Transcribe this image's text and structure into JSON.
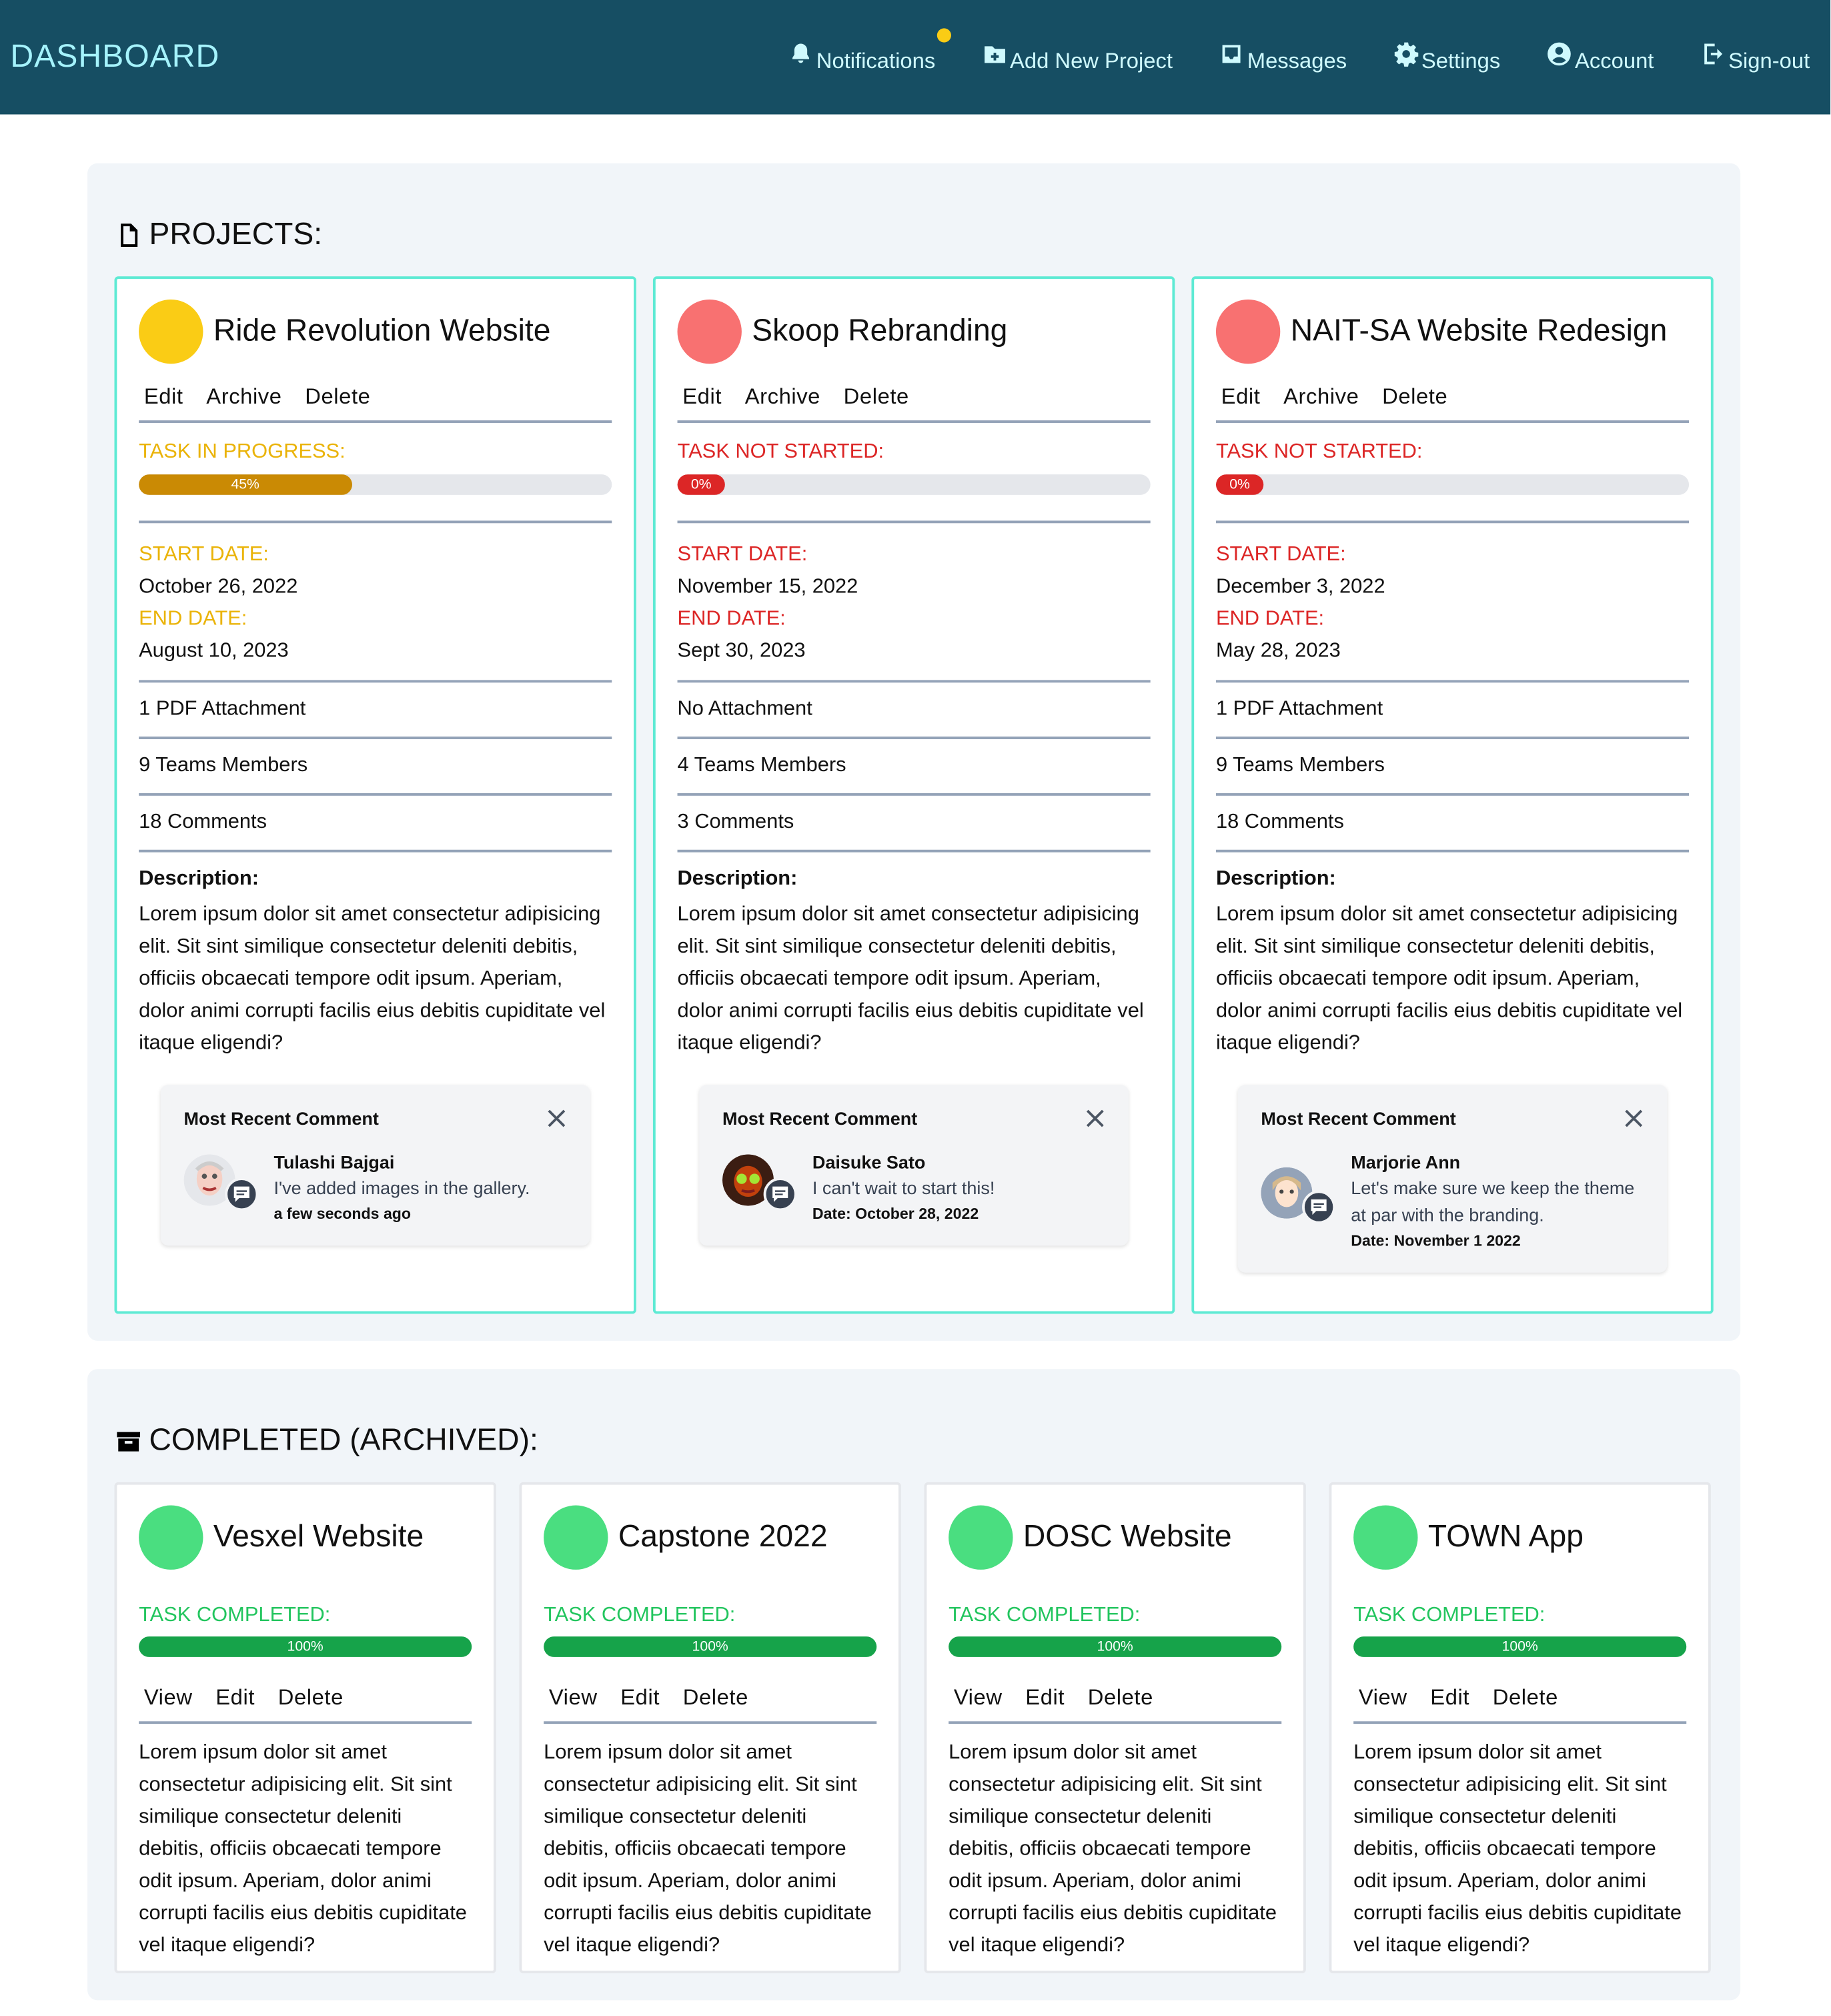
{
  "brand": "DASHBOARD",
  "nav": [
    {
      "label": "Notifications",
      "icon": "bell-icon"
    },
    {
      "label": "Add New Project",
      "icon": "folder-plus-icon"
    },
    {
      "label": "Messages",
      "icon": "inbox-icon"
    },
    {
      "label": "Settings",
      "icon": "gear-icon"
    },
    {
      "label": "Account",
      "icon": "user-circle-icon"
    },
    {
      "label": "Sign-out",
      "icon": "sign-out-icon"
    }
  ],
  "colors": {
    "header": "#164e63",
    "in_progress": "#eab308",
    "in_progress_bar": "#ca8a04",
    "not_started": "#dc2626",
    "not_started_dot": "#f87171",
    "completed": "#22c55e",
    "completed_dot": "#4ade80",
    "card_border": "#5eead4",
    "notif_dot": "#facc15"
  },
  "projects_section": {
    "title": "PROJECTS:",
    "actions": [
      "Edit",
      "Archive",
      "Delete"
    ],
    "start_label": "START DATE:",
    "end_label": "END DATE:",
    "description_label": "Description:",
    "comment_header": "Most Recent Comment",
    "cards": [
      {
        "title": "Ride Revolution Website",
        "status": "TASK IN PROGRESS:",
        "progress": 45,
        "progress_label": "45%",
        "start": "October 26, 2022",
        "end": "August 10, 2023",
        "attachment": "1 PDF Attachment",
        "members": "9 Teams Members",
        "comments": "18 Comments",
        "description": "Lorem ipsum dolor sit amet consectetur adipisicing elit. Sit sint similique consectetur deleniti debitis, officiis obcaecati tempore odit ipsum. Aperiam, dolor animi corrupti facilis eius debitis cupiditate vel itaque eligendi?",
        "comment_author": "Tulashi Bajgai",
        "comment_text": "I've added images in the gallery.",
        "comment_date": "a few seconds ago"
      },
      {
        "title": "Skoop Rebranding",
        "status": "TASK NOT STARTED:",
        "progress": 0,
        "progress_label": "0%",
        "start": "November 15, 2022",
        "end": "Sept 30, 2023",
        "attachment": "No Attachment",
        "members": "4 Teams Members",
        "comments": "3 Comments",
        "description": "Lorem ipsum dolor sit amet consectetur adipisicing elit. Sit sint similique consectetur deleniti debitis, officiis obcaecati tempore odit ipsum. Aperiam, dolor animi corrupti facilis eius debitis cupiditate vel itaque eligendi?",
        "comment_author": "Daisuke Sato",
        "comment_text": "I can't wait to start this!",
        "comment_date": "Date: October 28, 2022"
      },
      {
        "title": "NAIT-SA Website Redesign",
        "status": "TASK NOT STARTED:",
        "progress": 0,
        "progress_label": "0%",
        "start": "December 3, 2022",
        "end": "May 28, 2023",
        "attachment": "1 PDF Attachment",
        "members": "9 Teams Members",
        "comments": "18 Comments",
        "description": "Lorem ipsum dolor sit amet consectetur adipisicing elit. Sit sint similique consectetur deleniti debitis, officiis obcaecati tempore odit ipsum. Aperiam, dolor animi corrupti facilis eius debitis cupiditate vel itaque eligendi?",
        "comment_author": "Marjorie Ann",
        "comment_text": "Let's make sure we keep the theme at par with the branding.",
        "comment_date": "Date: November 1 2022"
      }
    ]
  },
  "archived_section": {
    "title": "COMPLETED (ARCHIVED):",
    "actions": [
      "View",
      "Edit",
      "Delete"
    ],
    "status": "TASK COMPLETED:",
    "progress": 100,
    "progress_label": "100%",
    "cards": [
      {
        "title": "Vesxel Website",
        "description": "Lorem ipsum dolor sit amet consectetur adipisicing elit. Sit sint similique consectetur deleniti debitis, officiis obcaecati tempore odit ipsum. Aperiam, dolor animi corrupti facilis eius debitis cupiditate vel itaque eligendi?"
      },
      {
        "title": "Capstone 2022",
        "description": "Lorem ipsum dolor sit amet consectetur adipisicing elit. Sit sint similique consectetur deleniti debitis, officiis obcaecati tempore odit ipsum. Aperiam, dolor animi corrupti facilis eius debitis cupiditate vel itaque eligendi?"
      },
      {
        "title": "DOSC Website",
        "description": "Lorem ipsum dolor sit amet consectetur adipisicing elit. Sit sint similique consectetur deleniti debitis, officiis obcaecati tempore odit ipsum. Aperiam, dolor animi corrupti facilis eius debitis cupiditate vel itaque eligendi?"
      },
      {
        "title": "TOWN App",
        "description": "Lorem ipsum dolor sit amet consectetur adipisicing elit. Sit sint similique consectetur deleniti debitis, officiis obcaecati tempore odit ipsum. Aperiam, dolor animi corrupti facilis eius debitis cupiditate vel itaque eligendi?"
      }
    ]
  }
}
